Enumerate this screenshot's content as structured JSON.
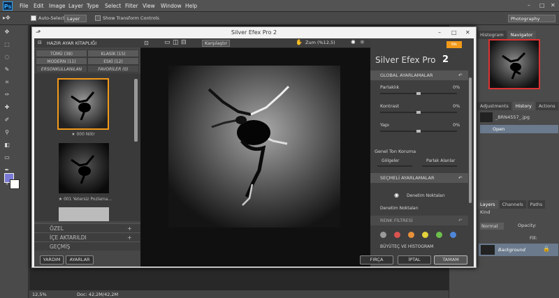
{
  "menubar": {
    "logo": "Ps",
    "items": [
      "File",
      "Edit",
      "Image",
      "Layer",
      "Type",
      "Select",
      "Filter",
      "View",
      "Window",
      "Help"
    ],
    "window_buttons": [
      "–",
      "□",
      "✕"
    ]
  },
  "options": {
    "auto_select_label": "Auto-Select:",
    "auto_select_value": "Layer",
    "transform_label": "Show Transform Controls",
    "workspace": "Photography"
  },
  "status": {
    "zoom": "12,5%",
    "doc": "Doc: 42,2M/42,2M"
  },
  "right_panel": {
    "tabs_top": [
      "Histogram",
      "Navigator"
    ],
    "tabs_mid": [
      "Adjustments",
      "History",
      "Actions"
    ],
    "history_items": [
      "_BRN4557_.jpg",
      "Open"
    ],
    "tabs_layers": [
      "Layers",
      "Channels",
      "Paths"
    ],
    "kind": "Kind",
    "blend": "Normal",
    "opacity_label": "Opacity:",
    "fill_label": "Fill:",
    "layer_name": "Background"
  },
  "dialog": {
    "title": "Silver Efex Pro 2",
    "left": {
      "header": "HAZIR AYAR KİTAPLIĞI",
      "tabs": [
        "TÜMÜ (38)",
        "KLASİK (15)",
        "MODERN (11)",
        "ESKİ (12)"
      ],
      "subtabs": [
        "ERSONKULLANILAN",
        "FAVORİLER (0)"
      ],
      "presets": [
        "★ 000 Nötr",
        "★ 001 Yetersiz Pozlama..."
      ],
      "sections": [
        "ÖZEL",
        "İÇE AKTARILDI",
        "GEÇMİŞ"
      ],
      "buttons": [
        "YARDIM",
        "AYARLAR"
      ]
    },
    "center": {
      "compare": "Karşılaştır",
      "zoom": "Zum (%12,5)"
    },
    "right": {
      "brand": "Silver Efex Pro",
      "version": "2",
      "badge": "Nik",
      "global": "GLOBAL AYARLAMALAR",
      "params": [
        {
          "label": "Parlaklık",
          "value": "0%"
        },
        {
          "label": "Kontrast",
          "value": "0%"
        },
        {
          "label": "Yapı",
          "value": "0%"
        }
      ],
      "tone": "Genel Ton Koruma",
      "shadows": "Gölgeler",
      "highlights": "Parlak Alanlar",
      "selective": "SEÇMELİ AYARLAMALAR",
      "control_points": "Denetim Noktaları",
      "control_points2": "Denetim Noktaları",
      "color_filters": "RENK FİLTRESİ",
      "loupe": "BÜYÜTEÇ VE HİSTOGRAM",
      "buttons": [
        "FIRÇA",
        "İPTAL",
        "TAMAM"
      ]
    }
  },
  "colors": {
    "accent": "#f39a1a",
    "fg_swatch": "#7a7ad6",
    "filter_dots": [
      "#9a9a9a",
      "#d9534f",
      "#e8913a",
      "#e2d13b",
      "#6dbf4b",
      "#4f87d8"
    ]
  }
}
